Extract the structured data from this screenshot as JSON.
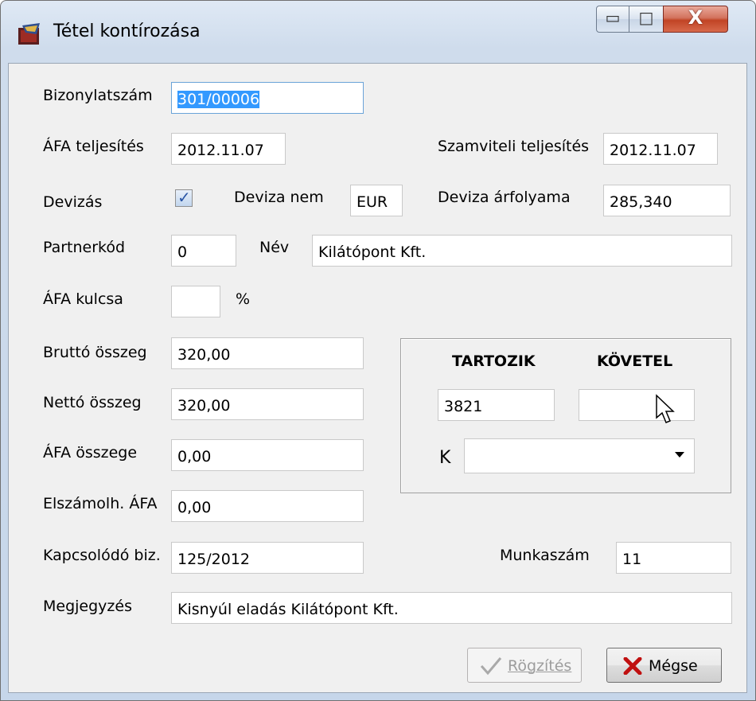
{
  "window": {
    "title": "Tétel kontírozása",
    "minimize_glyph": "▭",
    "maximize_glyph": "□",
    "close_glyph": "X"
  },
  "form": {
    "bizonylatszam": {
      "label": "Bizonylatszám",
      "value": "301/00006"
    },
    "afa_teljesites": {
      "label": "ÁFA teljesítés",
      "value": "2012.11.07"
    },
    "szamviteli_teljesites": {
      "label": "Szamviteli teljesítés",
      "value": "2012.11.07"
    },
    "devizas": {
      "label": "Devizás",
      "checked": true
    },
    "deviza_nem": {
      "label": "Deviza nem",
      "value": "EUR"
    },
    "deviza_arfolyama": {
      "label": "Deviza árfolyama",
      "value": "285,340"
    },
    "partnerkod": {
      "label": "Partnerkód",
      "value": "0"
    },
    "nev": {
      "label": "Név",
      "value": "Kilátópont Kft."
    },
    "afa_kulcsa": {
      "label": "ÁFA kulcsa",
      "value": "",
      "unit": "%"
    },
    "brutto_osszeg": {
      "label": "Bruttó összeg",
      "value": "320,00"
    },
    "netto_osszeg": {
      "label": "Nettó összeg",
      "value": "320,00"
    },
    "afa_osszege": {
      "label": "ÁFA összege",
      "value": "0,00"
    },
    "elszamolh_afa": {
      "label": "Elszámolh. ÁFA",
      "value": "0,00"
    },
    "kapcsolodo_biz": {
      "label": "Kapcsolódó biz.",
      "value": "125/2012"
    },
    "munkaszam": {
      "label": "Munkaszám",
      "value": "11"
    },
    "megjegyzes": {
      "label": "Megjegyzés",
      "value": "Kisnyúl eladás Kilátópont Kft."
    }
  },
  "account_panel": {
    "tartozik": {
      "header": "TARTOZIK",
      "value": "3821"
    },
    "kovetel": {
      "header": "KÖVETEL",
      "value": ""
    },
    "k_label": "K",
    "k_select": {
      "value": ""
    }
  },
  "buttons": {
    "rogzites": {
      "label": "Rögzítés",
      "enabled": false
    },
    "megse": {
      "label": "Mégse",
      "enabled": true
    }
  },
  "icons": {
    "app": "app-icon",
    "checkmark": "check-icon",
    "cancel": "red-x-icon",
    "cursor": "mouse-pointer-icon"
  }
}
